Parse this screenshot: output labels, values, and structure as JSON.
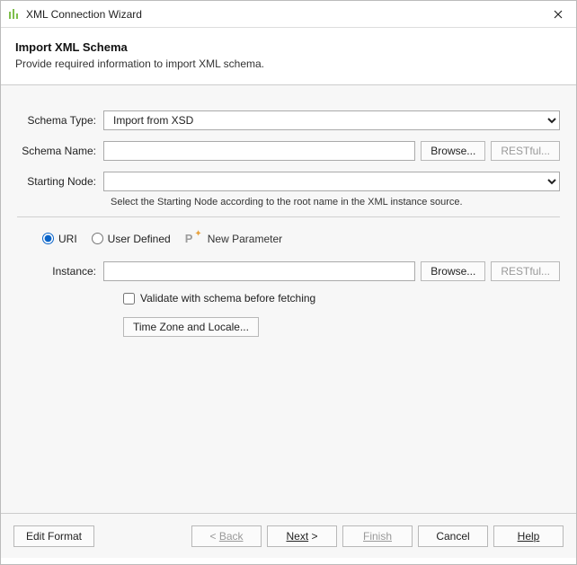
{
  "window": {
    "title": "XML Connection Wizard"
  },
  "header": {
    "title": "Import XML Schema",
    "subtitle": "Provide required information to import XML schema."
  },
  "form": {
    "schema_type_label": "Schema Type:",
    "schema_type_value": "Import from XSD",
    "schema_name_label": "Schema Name:",
    "schema_name_value": "",
    "browse_label": "Browse...",
    "restful_label": "RESTful...",
    "starting_node_label": "Starting Node:",
    "starting_node_value": "",
    "starting_node_hint": "Select the Starting Node according to the root name in the XML instance source."
  },
  "source": {
    "radio_uri": "URI",
    "radio_user_defined": "User Defined",
    "new_parameter_label": "New Parameter",
    "instance_label": "Instance:",
    "instance_value": "",
    "browse_label": "Browse...",
    "restful_label": "RESTful...",
    "validate_label": "Validate with schema before fetching",
    "tz_button": "Time Zone and Locale..."
  },
  "footer": {
    "edit_format": "Edit Format",
    "back": "Back",
    "next": "Next",
    "finish": "Finish",
    "cancel": "Cancel",
    "help": "Help"
  }
}
